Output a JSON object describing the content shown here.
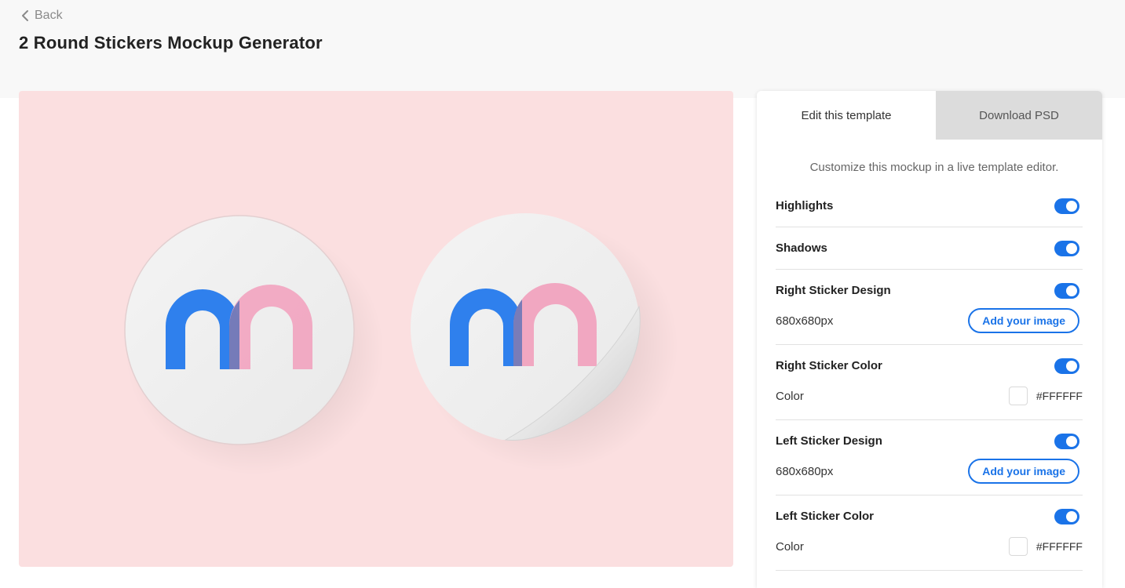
{
  "nav": {
    "back_label": "Back"
  },
  "page": {
    "title": "2 Round Stickers Mockup Generator"
  },
  "tabs": [
    {
      "label": "Edit this template",
      "active": true
    },
    {
      "label": "Download PSD",
      "active": false
    }
  ],
  "panel": {
    "intro": "Customize this mockup in a live template editor.",
    "options": {
      "highlights": {
        "label": "Highlights",
        "enabled": true
      },
      "shadows": {
        "label": "Shadows",
        "enabled": true
      },
      "right_design": {
        "label": "Right Sticker Design",
        "enabled": true,
        "size": "680x680px",
        "button": "Add your image"
      },
      "right_color": {
        "label": "Right Sticker Color",
        "enabled": true,
        "sub_label": "Color",
        "value": "#FFFFFF"
      },
      "left_design": {
        "label": "Left Sticker Design",
        "enabled": true,
        "size": "680x680px",
        "button": "Add your image"
      },
      "left_color": {
        "label": "Left Sticker Color",
        "enabled": true,
        "sub_label": "Color",
        "value": "#FFFFFF"
      }
    }
  },
  "colors": {
    "accent": "#1a73e8",
    "preview_background": "#fbdfe0",
    "logo_blue": "#2f80ed",
    "logo_pink": "#f1a7c1"
  }
}
